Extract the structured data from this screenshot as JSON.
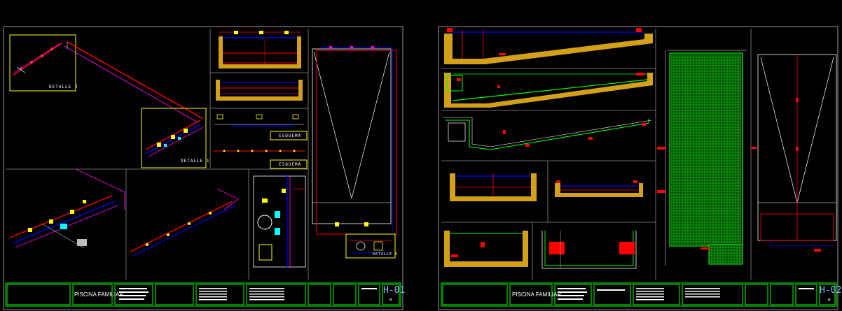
{
  "sheet_left": {
    "detail_labels": {
      "detail_2": "DETALLE 2",
      "detail_1": "DETALLE 1",
      "detail_3": "DETALLE 3"
    },
    "schematic_labels": {
      "upper": "ESQUEMA",
      "lower": "ESQUEMA"
    },
    "title_block": {
      "project": "PISCINA FAMILIAR",
      "sheet_code": "H-01",
      "sheet_sub": "0"
    }
  },
  "sheet_right": {
    "title_block": {
      "project": "PISCINA FAMILIAR",
      "sheet_code": "H-02",
      "sheet_sub": "0"
    }
  },
  "colors": {
    "background": "#000000",
    "frame": "#ffffff",
    "title_block": "#00ff00",
    "pipe_red": "#ff0000",
    "pipe_blue": "#0000ff",
    "pipe_magenta": "#ff00ff",
    "concrete": "#d4a017",
    "mesh": "#00ff00",
    "label_box": "#ffff00"
  },
  "icons": {
    "tank": "circle-tank-icon",
    "valve": "valve-icon"
  }
}
